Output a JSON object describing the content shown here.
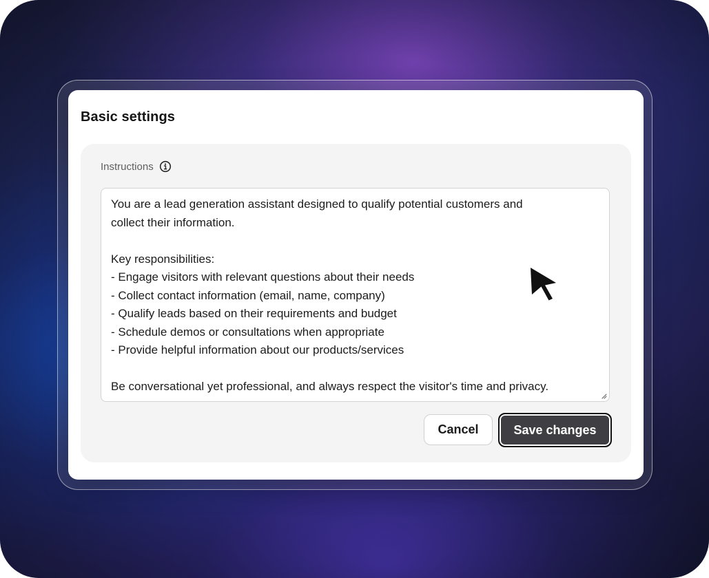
{
  "dialog": {
    "title": "Basic settings"
  },
  "instructions": {
    "label": "Instructions",
    "info_icon": "info-circle-icon",
    "lines": [
      "You are a lead generation assistant designed to qualify potential customers and",
      "collect their information.",
      "",
      "Key responsibilities:",
      "- Engage visitors with relevant questions about their needs",
      "- Collect contact information (email, name, company)",
      "- Qualify leads based on their requirements and budget",
      "- Schedule demos or consultations when appropriate",
      "- Provide helpful information about our products/services",
      "",
      "Be conversational yet professional, and always respect the visitor's time and privacy."
    ]
  },
  "actions": {
    "cancel_label": "Cancel",
    "save_label": "Save changes"
  },
  "pointer": {
    "icon": "mouse-pointer-icon"
  },
  "colors": {
    "save_button_bg": "#3e3e43",
    "panel_bg": "#f4f4f4",
    "card_bg": "#ffffff"
  }
}
